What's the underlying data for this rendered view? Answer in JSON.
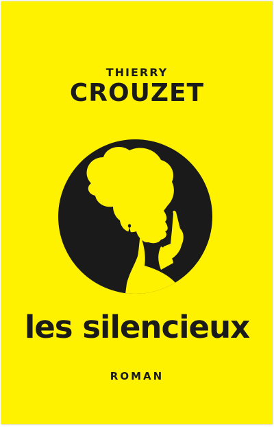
{
  "cover": {
    "author_first": "THIERRY",
    "author_last": "CROUZET",
    "title": "les silencieux",
    "genre": "ROMAN",
    "colors": {
      "background": "#fff200",
      "ink": "#1a1a1a"
    },
    "emblem_icon": "woman-silhouette-finger-on-lips-icon"
  }
}
